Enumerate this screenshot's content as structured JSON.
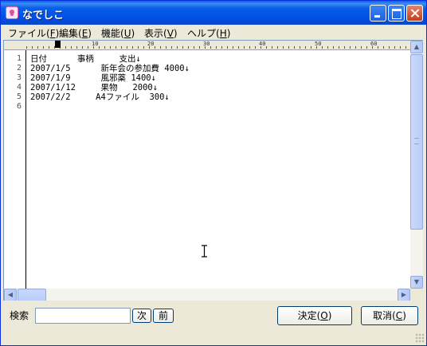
{
  "window": {
    "title": "なでしこ"
  },
  "menu": [
    {
      "label": "ファイル(",
      "key": "F",
      "tail": ")"
    },
    {
      "label": "編集(",
      "key": "E",
      "tail": ")"
    },
    {
      "label": "機能(",
      "key": "U",
      "tail": ")"
    },
    {
      "label": "表示(",
      "key": "V",
      "tail": ")"
    },
    {
      "label": "ヘルプ(",
      "key": "H",
      "tail": ")"
    }
  ],
  "ruler": {
    "marks": [
      "10",
      "20",
      "30",
      "40",
      "50",
      "60"
    ]
  },
  "editor": {
    "lines": [
      {
        "no": "1",
        "text": "日付      事柄     支出↓"
      },
      {
        "no": "2",
        "text": "2007/1/5      新年会の参加費 4000↓"
      },
      {
        "no": "3",
        "text": "2007/1/9      風邪薬 1400↓"
      },
      {
        "no": "4",
        "text": "2007/1/12     果物   2000↓"
      },
      {
        "no": "5",
        "text": "2007/2/2     A4ファイル  300↓"
      },
      {
        "no": "6",
        "text": ""
      }
    ]
  },
  "search": {
    "label": "検索",
    "value": "",
    "next_label": "次",
    "prev_label": "前"
  },
  "buttons": {
    "ok": {
      "label": "決定(",
      "key": "O",
      "tail": ")"
    },
    "cancel": {
      "label": "取消(",
      "key": "C",
      "tail": ")"
    }
  },
  "icons": {
    "app": "nadeshiko-flower-icon",
    "minimize": "minimize-icon",
    "maximize": "maximize-icon",
    "close": "close-icon",
    "scroll_up": "arrow-up-icon",
    "scroll_down": "arrow-down-icon",
    "scroll_left": "arrow-left-icon",
    "scroll_right": "arrow-right-icon",
    "cursor": "text-cursor-icon"
  }
}
